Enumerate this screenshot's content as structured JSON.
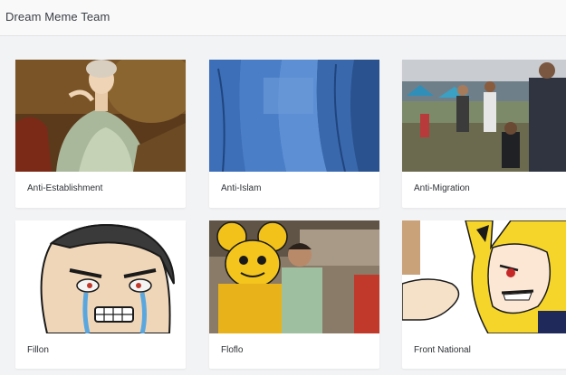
{
  "header": {
    "title": "Dream Meme Team"
  },
  "cards": [
    {
      "label": "Anti-Establishment"
    },
    {
      "label": "Anti-Islam"
    },
    {
      "label": "Anti-Migration"
    },
    {
      "label": "Fillon"
    },
    {
      "label": "Floflo"
    },
    {
      "label": "Front National"
    }
  ],
  "colors": {
    "page_background": "#f2f3f5",
    "header_background": "#f9f9fa",
    "card_background": "#ffffff",
    "text": "#2f3237"
  }
}
